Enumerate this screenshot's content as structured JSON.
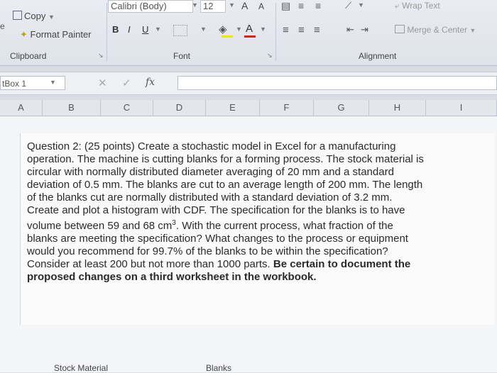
{
  "ribbon": {
    "clipboard": {
      "copy_label": "Copy",
      "format_painter_label": "Format Painter",
      "group_label": "Clipboard",
      "partial_left": "e"
    },
    "font": {
      "font_name": "Calibri (Body)",
      "font_size": "12",
      "bold": "B",
      "italic": "I",
      "underline": "U",
      "grow": "A",
      "shrink": "A",
      "font_color": "A",
      "group_label": "Font"
    },
    "alignment": {
      "wrap_text_label": "Wrap Text",
      "merge_center_label": "Merge & Center",
      "group_label": "Alignment"
    }
  },
  "formula_bar": {
    "name_box": "tBox 1",
    "cancel": "✕",
    "confirm": "✓",
    "fx": "fx"
  },
  "columns": [
    "A",
    "B",
    "C",
    "D",
    "E",
    "F",
    "G",
    "H",
    "I"
  ],
  "question": {
    "line1": "Question 2: (25 points) Create a stochastic model in Excel for a manufacturing",
    "line2": "operation. The machine is cutting blanks for a forming process. The stock material is",
    "line3": "circular with normally distributed diameter averaging of 20 mm and a standard",
    "line4": "deviation of 0.5 mm.  The blanks are cut to an average length of 200 mm. The length",
    "line5": "of the blanks cut are normally distributed with a standard deviation of 3.2 mm.",
    "line6": "Create and plot a histogram with CDF. The specification for the blanks is to have",
    "line7_a": "volume between 59 and 68 cm",
    "line7_sup": "3",
    "line7_b": ". With the current process, what fraction of the",
    "line8": "blanks are meeting the specification? What changes to the process or equipment",
    "line9": "would you recommend for 99.7% of the blanks to be within the specification?",
    "line10_a": "Consider at least 200 but not more than 1000 parts.  ",
    "line10_bold": "Be certain to document the",
    "line11_bold": "proposed changes on a third worksheet in the workbook."
  },
  "bottom": {
    "stock_label": "Stock Material",
    "blanks_label": "Blanks"
  }
}
